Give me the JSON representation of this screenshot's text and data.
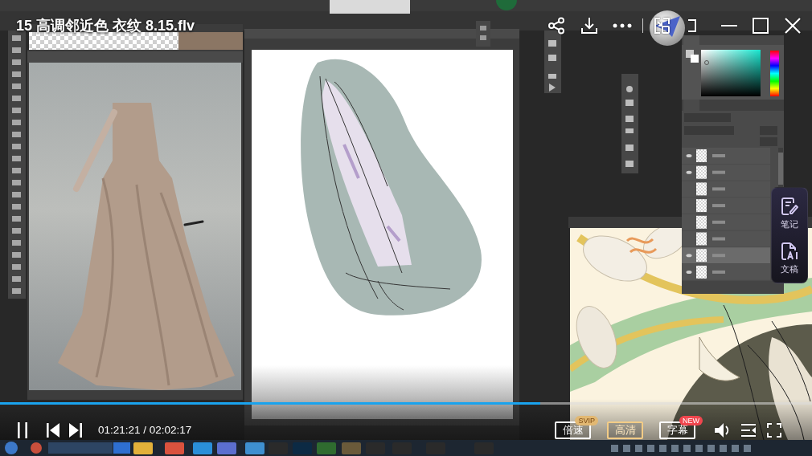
{
  "player": {
    "title": "15 高调邻近色 衣纹 8.15.flv",
    "playing": true,
    "time": "01:21:21 / 02:02:17",
    "progress": {
      "level": 0.665
    }
  },
  "side_panel": {
    "items": [
      {
        "kind": "note",
        "label": "笔记"
      },
      {
        "kind": "transcript",
        "label": "文稿"
      }
    ]
  },
  "control_buttons": [
    {
      "label": "倍速",
      "highlighted": false,
      "badge": {
        "kind": "vip",
        "text": "SVIP"
      }
    },
    {
      "label": "高清",
      "highlighted": true
    },
    {
      "label": "字幕",
      "highlighted": false,
      "badge": {
        "kind": "new",
        "text": "NEW"
      }
    }
  ]
}
